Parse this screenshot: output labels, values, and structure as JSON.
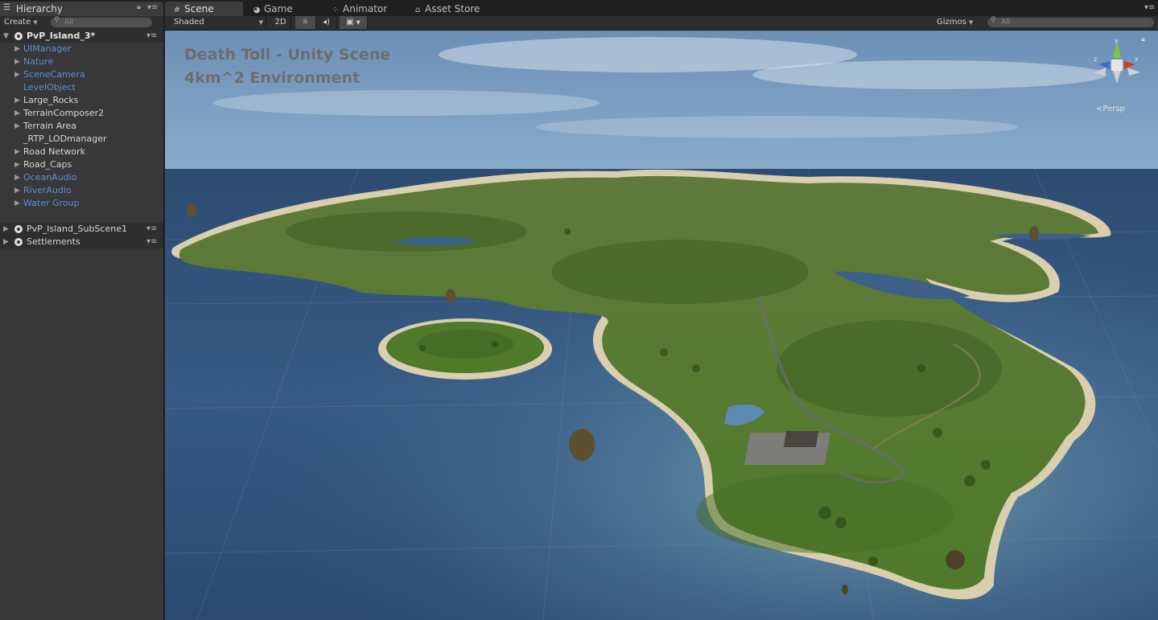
{
  "hierarchy": {
    "tab_label": "Hierarchy",
    "create_label": "Create",
    "search_placeholder": "All",
    "scenes": [
      {
        "name": "PvP_Island_3*",
        "expanded": true,
        "children": [
          {
            "label": "UIManager",
            "color": "#5e8ed6",
            "has_children": true
          },
          {
            "label": "Nature",
            "color": "#5e8ed6",
            "has_children": true
          },
          {
            "label": "SceneCamera",
            "color": "#5e8ed6",
            "has_children": true
          },
          {
            "label": "LevelObject",
            "color": "#5e8ed6",
            "has_children": false
          },
          {
            "label": "Large_Rocks",
            "color": "#d6d6d6",
            "has_children": true
          },
          {
            "label": "TerrainComposer2",
            "color": "#d6d6d6",
            "has_children": true
          },
          {
            "label": "Terrain Area",
            "color": "#d6d6d6",
            "has_children": true
          },
          {
            "label": "_RTP_LODmanager",
            "color": "#d6d6d6",
            "has_children": false
          },
          {
            "label": "Road Network",
            "color": "#d6d6d6",
            "has_children": true
          },
          {
            "label": "Road_Caps",
            "color": "#d6d6d6",
            "has_children": true
          },
          {
            "label": "OceanAudio",
            "color": "#5e8ed6",
            "has_children": true
          },
          {
            "label": "RiverAudio",
            "color": "#5e8ed6",
            "has_children": true
          },
          {
            "label": "Water Group",
            "color": "#5e8ed6",
            "has_children": true
          }
        ]
      },
      {
        "name": "PvP_Island_SubScene1",
        "expanded": false,
        "children": []
      },
      {
        "name": "Settlements",
        "expanded": false,
        "children": []
      }
    ]
  },
  "scene_view": {
    "tabs": [
      {
        "label": "Scene",
        "icon": "grid-icon",
        "active": true
      },
      {
        "label": "Game",
        "icon": "pacman-icon",
        "active": false
      },
      {
        "label": "Animator",
        "icon": "animator-icon",
        "active": false
      },
      {
        "label": "Asset Store",
        "icon": "store-bag-icon",
        "active": false
      }
    ],
    "toolbar": {
      "draw_mode": "Shaded",
      "mode_2d": "2D",
      "lighting_icon": "sun-icon",
      "audio_icon": "speaker-icon",
      "effects_icon": "image-icon",
      "gizmos_label": "Gizmos",
      "search_placeholder": "All"
    },
    "overlay": {
      "line1": "Death Toll - Unity Scene",
      "line2": "4km^2 Environment"
    },
    "projection_label": "Persp",
    "gizmo_axes": {
      "y": "y",
      "x": "x",
      "z": "z"
    }
  }
}
